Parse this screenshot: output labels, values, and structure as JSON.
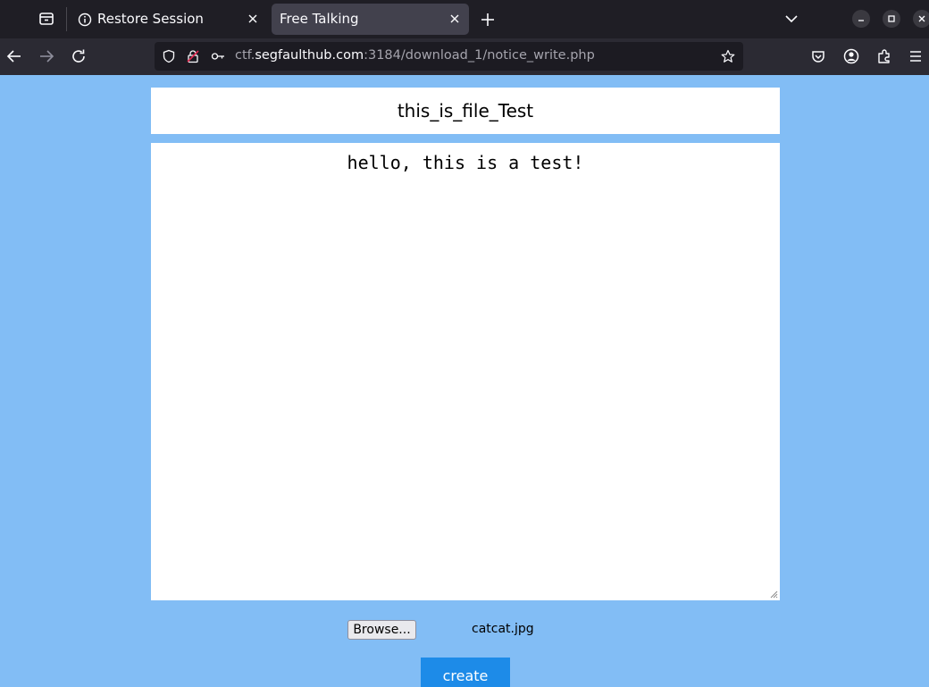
{
  "browser": {
    "tabs": [
      {
        "label": "Restore Session",
        "icon": "info-icon",
        "active": false
      },
      {
        "label": "Free Talking",
        "icon": "",
        "active": true
      }
    ],
    "url": {
      "prefix": "ctf.",
      "host": "segfaulthub.com",
      "path": ":3184/download_1/notice_write.php"
    }
  },
  "page": {
    "title": "this_is_file_Test",
    "content": "hello, this is a test!",
    "browse_label": "Browse...",
    "file_name": "catcat.jpg",
    "create_label": "create"
  },
  "colors": {
    "page_background": "#82bdf5",
    "create_button": "#1d8be8",
    "tabbar": "#1f1e25",
    "navbar": "#2b2a33"
  }
}
